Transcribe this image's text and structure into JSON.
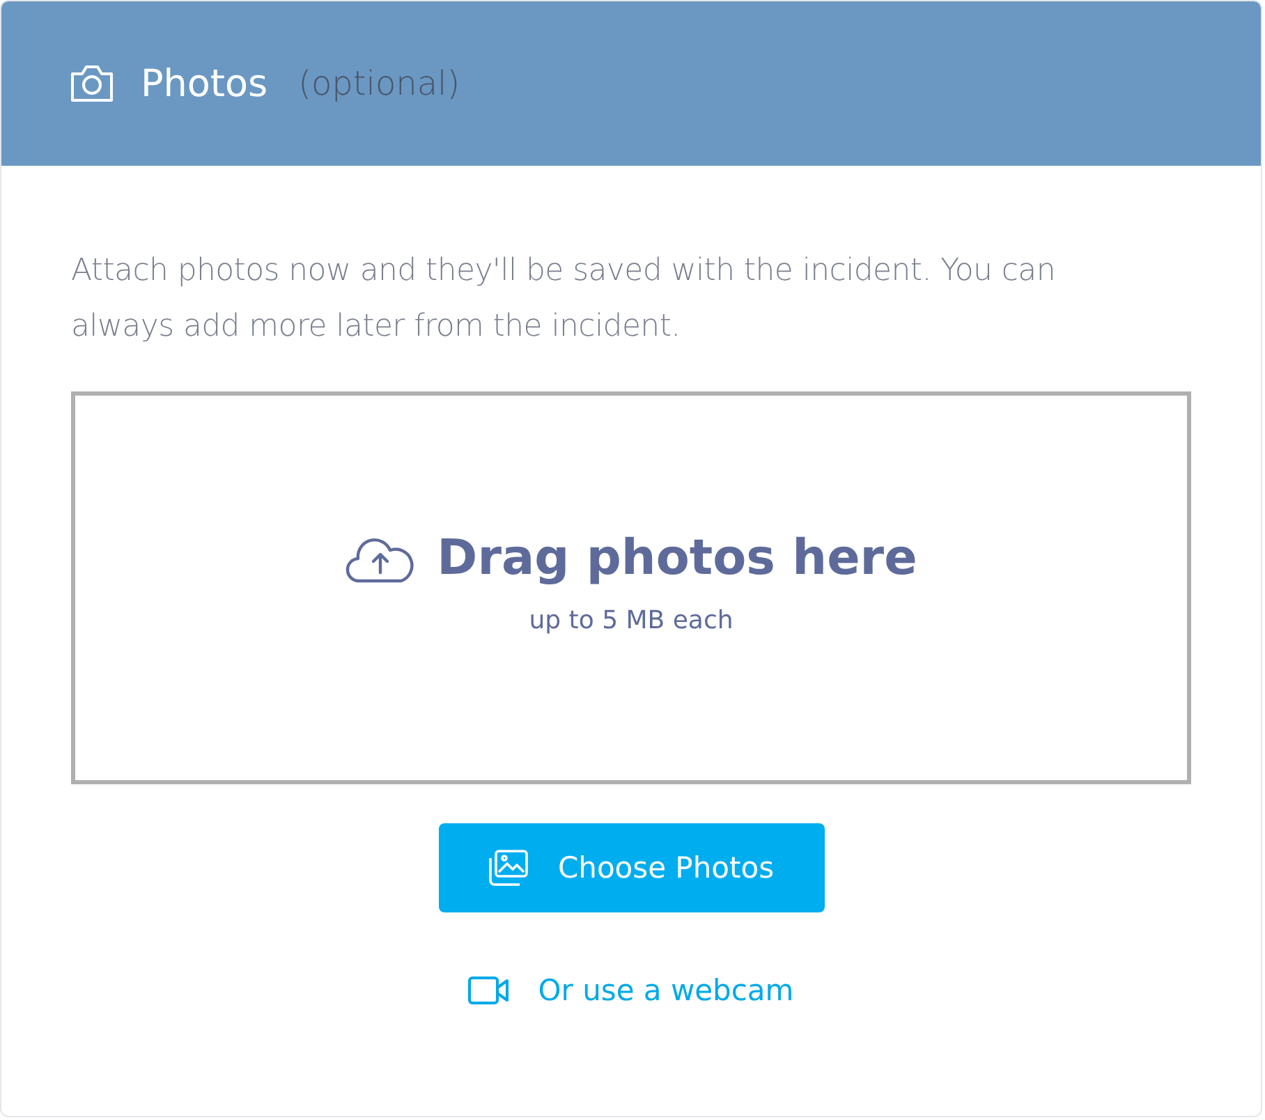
{
  "header": {
    "title": "Photos",
    "note": "(optional)"
  },
  "description": "Attach photos now and they'll be saved with the incident. You can always add more later from the incident.",
  "dropzone": {
    "title": "Drag photos here",
    "hint": "up to 5 MB each"
  },
  "choose_button": {
    "label": "Choose Photos"
  },
  "webcam_link": {
    "label": "Or use a webcam"
  }
}
